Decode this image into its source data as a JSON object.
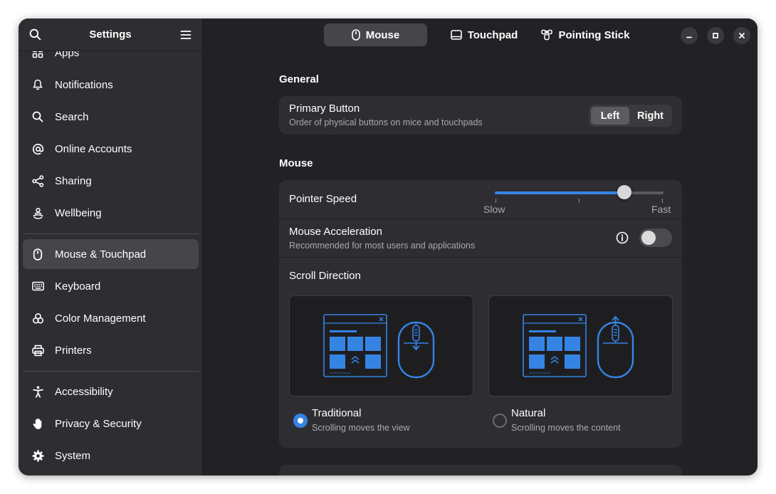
{
  "sidebar": {
    "title": "Settings",
    "items": [
      {
        "label": "Apps",
        "icon": "apps-icon"
      },
      {
        "label": "Notifications",
        "icon": "bell-icon"
      },
      {
        "label": "Search",
        "icon": "search-icon"
      },
      {
        "label": "Online Accounts",
        "icon": "at-icon"
      },
      {
        "label": "Sharing",
        "icon": "share-icon"
      },
      {
        "label": "Wellbeing",
        "icon": "wellbeing-icon"
      },
      {
        "label": "Mouse & Touchpad",
        "icon": "mouse-icon",
        "active": true
      },
      {
        "label": "Keyboard",
        "icon": "keyboard-icon"
      },
      {
        "label": "Color Management",
        "icon": "color-icon"
      },
      {
        "label": "Printers",
        "icon": "printer-icon"
      },
      {
        "label": "Accessibility",
        "icon": "accessibility-icon"
      },
      {
        "label": "Privacy & Security",
        "icon": "hand-icon"
      },
      {
        "label": "System",
        "icon": "gear-icon"
      }
    ]
  },
  "tabs": [
    {
      "label": "Mouse",
      "icon": "mouse-icon",
      "active": true
    },
    {
      "label": "Touchpad",
      "icon": "touchpad-icon"
    },
    {
      "label": "Pointing Stick",
      "icon": "pointing-stick-icon"
    }
  ],
  "general": {
    "title": "General",
    "primary_button": {
      "title": "Primary Button",
      "subtitle": "Order of physical buttons on mice and touchpads",
      "options": [
        "Left",
        "Right"
      ],
      "selected": "Left"
    }
  },
  "mouse": {
    "title": "Mouse",
    "pointer_speed": {
      "title": "Pointer Speed",
      "min_label": "Slow",
      "max_label": "Fast",
      "value": 0.77
    },
    "acceleration": {
      "title": "Mouse Acceleration",
      "subtitle": "Recommended for most users and applications",
      "enabled": false
    },
    "scroll_direction": {
      "title": "Scroll Direction",
      "options": [
        {
          "label": "Traditional",
          "subtitle": "Scrolling moves the view",
          "selected": true
        },
        {
          "label": "Natural",
          "subtitle": "Scrolling moves the content",
          "selected": false
        }
      ]
    }
  },
  "colors": {
    "accent": "#3584e4",
    "window_bg": "#222226",
    "sidebar_bg": "#2e2e32",
    "card_bg": "#2e2e32"
  }
}
